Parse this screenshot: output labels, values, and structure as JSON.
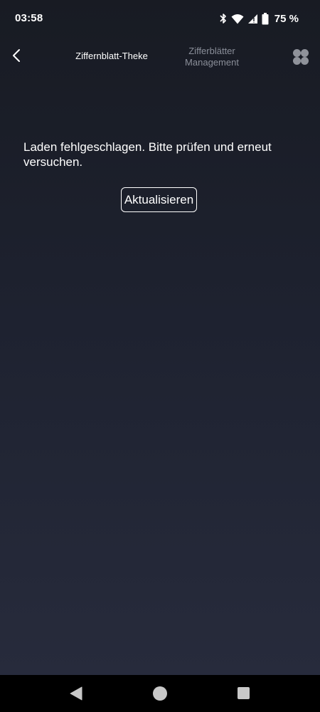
{
  "status_bar": {
    "time": "03:58",
    "battery_text": "75 %",
    "icons": [
      "bluetooth-icon",
      "wifi-icon",
      "cellular-signal-icon",
      "battery-icon"
    ]
  },
  "header": {
    "back_icon": "chevron-left-icon",
    "tab_active_label": "Ziffernblatt-Theke",
    "tab_inactive_label_line1": "Zifferblätter",
    "tab_inactive_label_line2": "Management",
    "menu_icon": "four-dots-grid-icon"
  },
  "main": {
    "error_message": "Laden fehlgeschlagen. Bitte prüfen und erneut versuchen.",
    "refresh_label": "Aktualisieren"
  },
  "system_nav": {
    "icons": [
      "nav-back-triangle-icon",
      "nav-home-circle-icon",
      "nav-recents-square-icon"
    ]
  },
  "colors": {
    "background_top": "#181b23",
    "background_bottom": "#282c3d",
    "text_primary": "#ffffff",
    "text_inactive": "#8a8e99",
    "grid_icon": "#8f929a"
  }
}
